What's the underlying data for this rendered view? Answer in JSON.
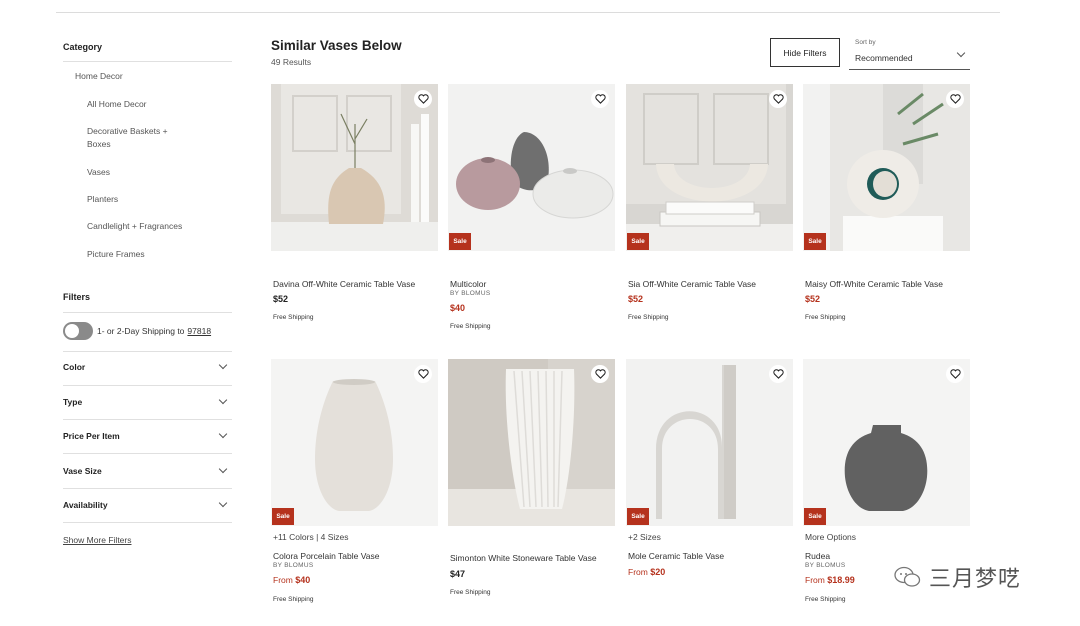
{
  "sidebar": {
    "category_heading": "Category",
    "category_parent": "Home Decor",
    "category_items": [
      "All Home Decor",
      "Decorative Baskets +\nBoxes",
      "Vases",
      "Planters",
      "Candlelight + Fragrances",
      "Picture Frames"
    ],
    "filters_heading": "Filters",
    "shipping_label": "1- or 2-Day Shipping to",
    "shipping_zip": "97818",
    "accordions": [
      "Color",
      "Type",
      "Price Per Item",
      "Vase Size",
      "Availability"
    ],
    "show_more": "Show More Filters"
  },
  "header": {
    "title": "Similar Vases Below",
    "results": "49 Results",
    "hide_filters": "Hide Filters",
    "sort_label": "Sort by",
    "sort_value": "Recommended"
  },
  "products": [
    {
      "name": "Davina Off-White Ceramic Table Vase",
      "price": "$52",
      "shipping": "Free Shipping",
      "sale": false
    },
    {
      "name": "Multicolor",
      "brand": "BY BLOMUS",
      "price": "$40",
      "shipping": "Free Shipping",
      "sale": true,
      "sale_label": "Sale"
    },
    {
      "name": "Sia Off-White Ceramic Table Vase",
      "price": "$52",
      "shipping": "Free Shipping",
      "sale": true,
      "sale_label": "Sale"
    },
    {
      "name": "Maisy Off-White Ceramic Table Vase",
      "price": "$52",
      "shipping": "Free Shipping",
      "sale": true,
      "sale_label": "Sale"
    },
    {
      "options": "+11 Colors | 4 Sizes",
      "name": "Colora Porcelain Table Vase",
      "brand": "BY BLOMUS",
      "from": "From",
      "price": "$40",
      "shipping": "Free Shipping",
      "sale": true,
      "sale_label": "Sale"
    },
    {
      "name": "Simonton White Stoneware Table Vase",
      "price": "$47",
      "shipping": "Free Shipping",
      "sale": false
    },
    {
      "options": "+2 Sizes",
      "name": "Mole Ceramic Table Vase",
      "from": "From",
      "price": "$20",
      "sale": true,
      "sale_label": "Sale"
    },
    {
      "options": "More Options",
      "name": "Rudea",
      "brand": "BY BLOMUS",
      "from": "From",
      "price": "$18.99",
      "shipping": "Free Shipping",
      "sale": true,
      "sale_label": "Sale"
    }
  ],
  "watermark": {
    "text": "三月梦呓"
  },
  "colors": {
    "sale_red": "#b5321d",
    "toggle_gray": "#8a8a8a"
  }
}
